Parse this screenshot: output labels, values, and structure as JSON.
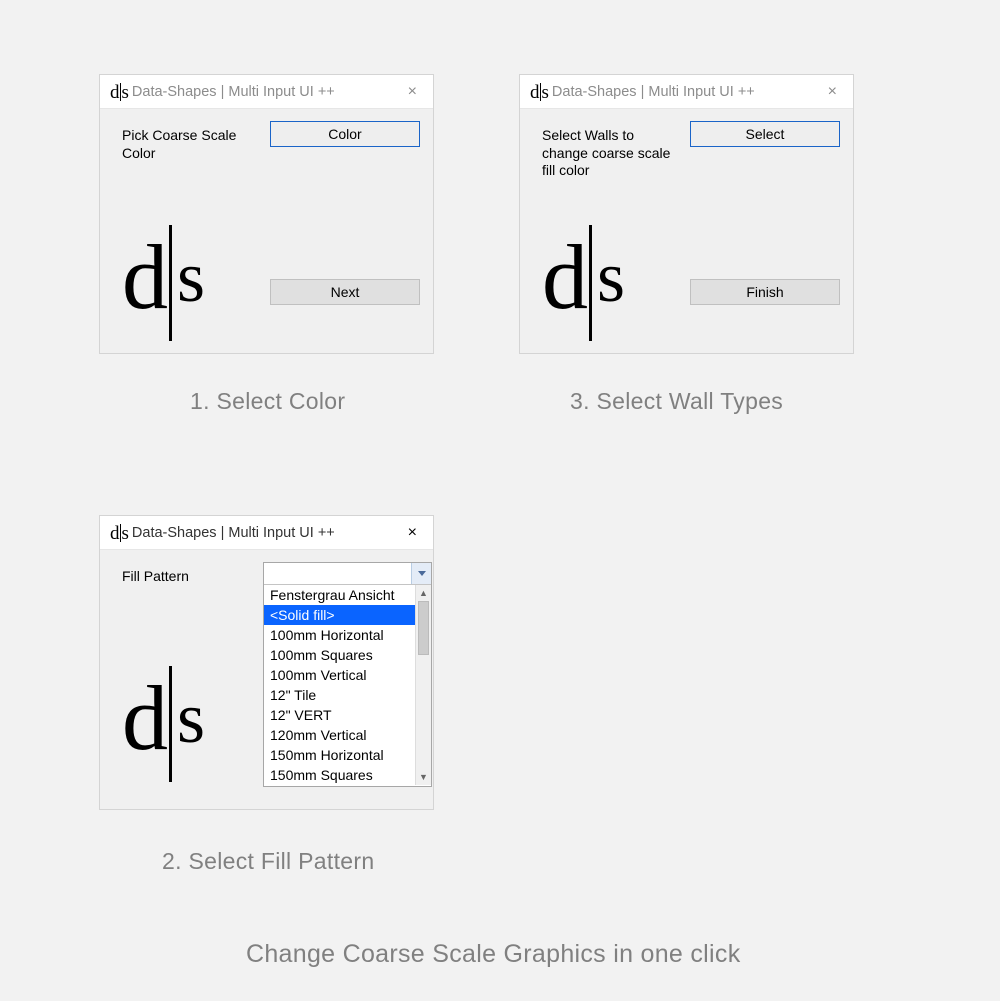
{
  "dialog1": {
    "title_prefix": "d|s",
    "title": "Data-Shapes | Multi Input UI ++",
    "close": "×",
    "prompt": "Pick Coarse Scale Color",
    "color_button": "Color",
    "next_button": "Next",
    "logo": "d|s"
  },
  "dialog3": {
    "title_prefix": "d|s",
    "title": "Data-Shapes | Multi Input UI ++",
    "close": "×",
    "prompt": "Select Walls to change coarse scale fill color",
    "select_button": "Select",
    "finish_button": "Finish",
    "logo": "d|s"
  },
  "dialog2": {
    "title_prefix": "d|s",
    "title": "Data-Shapes | Multi Input UI ++",
    "close": "×",
    "prompt": "Fill Pattern",
    "logo": "d|s",
    "dropdown": {
      "selected_index": 1,
      "items": [
        "Fenstergrau Ansicht",
        "<Solid fill>",
        "100mm Horizontal",
        "100mm Squares",
        "100mm Vertical",
        "12\" Tile",
        "12\" VERT",
        "120mm Vertical",
        "150mm Horizontal",
        "150mm Squares"
      ]
    }
  },
  "captions": {
    "c1": "1. Select Color",
    "c3": "3. Select Wall Types",
    "c2": "2. Select Fill Pattern",
    "footer": "Change Coarse Scale Graphics in one click"
  }
}
